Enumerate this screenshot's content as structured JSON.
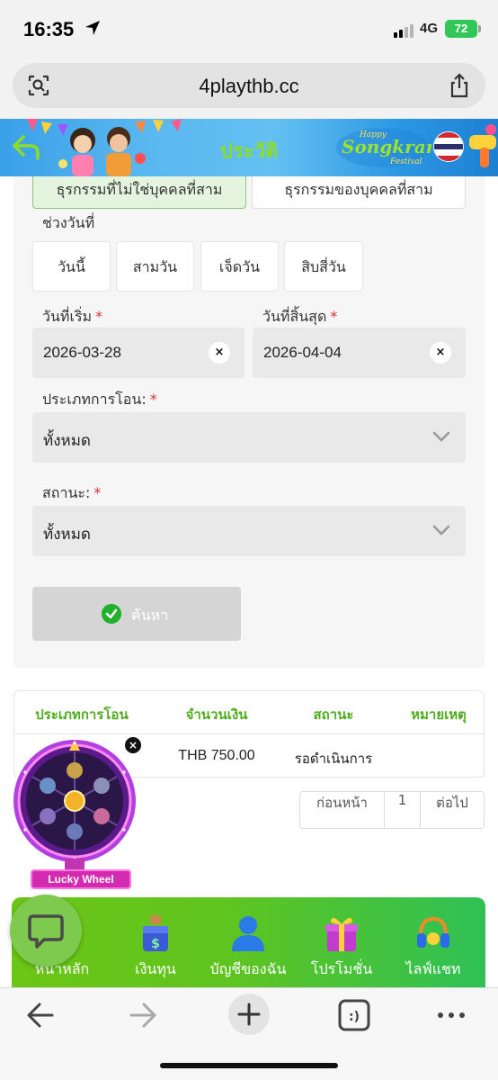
{
  "status_bar": {
    "time": "16:35",
    "network": "4G",
    "battery": "72"
  },
  "browser": {
    "url": "4playthb.cc"
  },
  "header": {
    "title": "ประวัติ",
    "banner_text_top": "Happy",
    "banner_text_main": "Songkran",
    "banner_text_bottom": "Festival"
  },
  "tabs": [
    {
      "label": "ธุรกรรมที่ไม่ใช่บุคคลที่สาม",
      "active": true
    },
    {
      "label": "ธุรกรรมของบุคคลที่สาม",
      "active": false
    }
  ],
  "form": {
    "range_label": "ช่วงวันที่",
    "ranges": [
      "วันนี้",
      "สามวัน",
      "เจ็ดวัน",
      "สิบสี่วัน"
    ],
    "start_label": "วันที่เริ่ม",
    "end_label": "วันที่สิ้นสุด",
    "required_mark": "*",
    "start_date": "2026-03-28",
    "end_date": "2026-04-04",
    "clear_symbol": "×",
    "type_label": "ประเภทการโอน:",
    "type_value": "ทั้งหมด",
    "status_label": "สถานะ:",
    "status_value": "ทั้งหมด",
    "search_label": "ค้นหา"
  },
  "table": {
    "headers": [
      "ประเภทการโอน",
      "จำนวนเงิน",
      "สถานะ",
      "หมายเหตุ"
    ],
    "rows": [
      {
        "type": "",
        "amount": "THB 750.00",
        "status": "รอดำเนินการ",
        "note": ""
      }
    ]
  },
  "pagination": {
    "prev": "ก่อนหน้า",
    "page": "1",
    "next": "ต่อไป"
  },
  "lucky_wheel": {
    "label": "Lucky Wheel",
    "close": "×"
  },
  "bottom_nav": [
    {
      "label": "หน้าหลัก",
      "icon": "home-icon"
    },
    {
      "label": "เงินทุน",
      "icon": "money-icon"
    },
    {
      "label": "บัญชีของฉัน",
      "icon": "account-icon"
    },
    {
      "label": "โปรโมชั่น",
      "icon": "gift-icon"
    },
    {
      "label": "ไลฟ์แชท",
      "icon": "headset-icon"
    }
  ],
  "colors": {
    "accent_green": "#4ead1c",
    "nav_green_start": "#6cc615",
    "nav_green_end": "#2fc156",
    "required_red": "#e03131"
  }
}
